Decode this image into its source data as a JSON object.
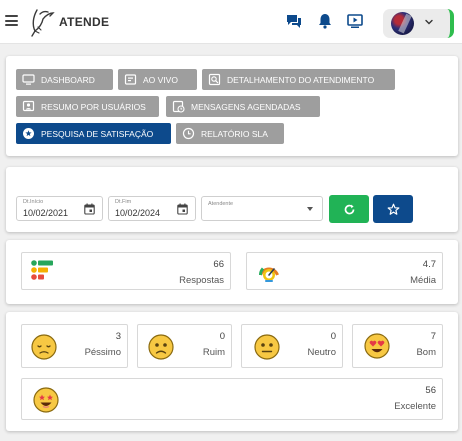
{
  "header": {
    "brand": "ATENDE",
    "icons": [
      "hamburger-menu-icon",
      "chat-icon",
      "bell-icon",
      "play-screen-icon",
      "chevron-down-icon"
    ],
    "accent_color": "#2fbd4e"
  },
  "nav": {
    "buttons": [
      {
        "label": "DASHBOARD",
        "icon": "monitor-icon"
      },
      {
        "label": "AO VIVO",
        "icon": "live-icon"
      },
      {
        "label": "DETALHAMENTO DO ATENDIMENTO",
        "icon": "report-icon"
      },
      {
        "label": "RESUMO POR USUÁRIOS",
        "icon": "user-summary-icon"
      },
      {
        "label": "MENSAGENS AGENDADAS",
        "icon": "scheduled-messages-icon"
      },
      {
        "label": "PESQUISA DE SATISFAÇÃO",
        "icon": "star-circle-icon",
        "active": true
      },
      {
        "label": "RELATÓRIO SLA",
        "icon": "clock-icon"
      }
    ],
    "default_color": "#9e9e9e",
    "active_color": "#0d4a8c"
  },
  "filters": {
    "start_label": "Dt.Início",
    "start_value": "10/02/2021",
    "end_label": "Dt.Fim",
    "end_value": "10/02/2024",
    "attendant_label": "Atendente",
    "refresh_color": "#21b356",
    "favorite_color": "#0d4a8c"
  },
  "summary": {
    "responses_value": "66",
    "responses_label": "Respostas",
    "average_value": "4.7",
    "average_label": "Média"
  },
  "ratings": {
    "pessimo_value": "3",
    "pessimo_label": "Péssimo",
    "ruim_value": "0",
    "ruim_label": "Ruim",
    "neutro_value": "0",
    "neutro_label": "Neutro",
    "bom_value": "7",
    "bom_label": "Bom",
    "excelente_value": "56",
    "excelente_label": "Excelente"
  }
}
